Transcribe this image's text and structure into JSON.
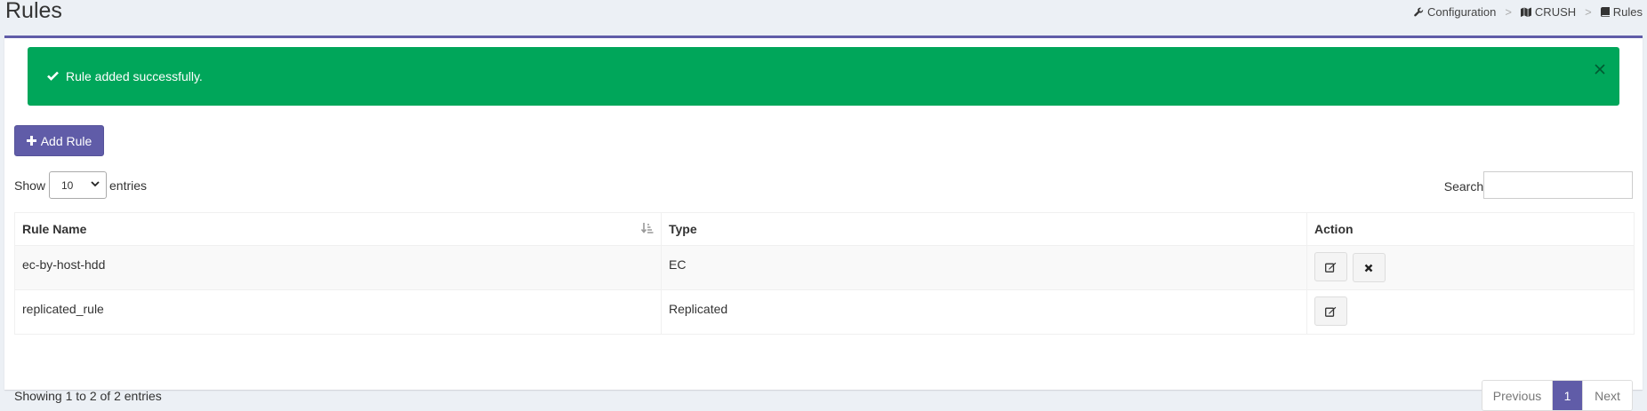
{
  "header": {
    "title": "Rules",
    "breadcrumb": [
      {
        "label": "Configuration",
        "icon": "wrench-icon"
      },
      {
        "label": "CRUSH",
        "icon": "map-icon"
      },
      {
        "label": "Rules",
        "icon": "book-icon"
      }
    ],
    "separator": ">"
  },
  "alert": {
    "message": "Rule added successfully.",
    "icon": "check-icon",
    "color": "#00a65a"
  },
  "toolbar": {
    "add_label": "Add Rule",
    "show_label": "Show",
    "entries_value": "10",
    "entries_label": "entries",
    "search_label": "Search:",
    "search_value": ""
  },
  "table": {
    "columns": [
      "Rule Name",
      "Type",
      "Action"
    ],
    "rows": [
      {
        "name": "ec-by-host-hdd",
        "type": "EC",
        "actions": [
          "edit",
          "delete"
        ]
      },
      {
        "name": "replicated_rule",
        "type": "Replicated",
        "actions": [
          "edit"
        ]
      }
    ]
  },
  "footer": {
    "info": "Showing 1 to 2 of 2 entries",
    "previous": "Previous",
    "current_page": "1",
    "next": "Next"
  },
  "colors": {
    "accent": "#605ca8",
    "success": "#00a65a",
    "background": "#ecf0f5"
  }
}
